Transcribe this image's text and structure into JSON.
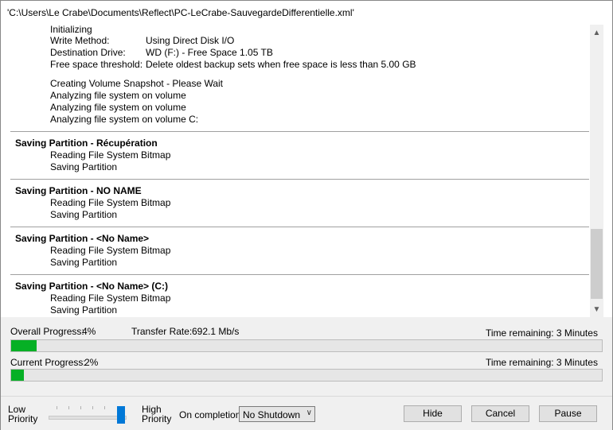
{
  "window": {
    "title": "'C:\\Users\\Le Crabe\\Documents\\Reflect\\PC-LeCrabe-SauvegardeDifferentielle.xml'"
  },
  "log": {
    "init": "Initializing",
    "params": [
      {
        "key": "Write Method:",
        "value": "Using Direct Disk I/O"
      },
      {
        "key": "Destination Drive:",
        "value": "WD (F:) - Free Space 1.05 TB"
      },
      {
        "key": "Free space threshold:",
        "value": "Delete oldest backup sets when free space is less than 5.00 GB"
      }
    ],
    "snapshot_lines": [
      "Creating Volume Snapshot - Please Wait",
      "Analyzing file system on volume",
      "Analyzing file system on volume",
      "Analyzing file system on volume C:"
    ],
    "sections": [
      {
        "title": "Saving Partition - Récupération",
        "lines": [
          "Reading File System Bitmap",
          "Saving Partition"
        ]
      },
      {
        "title": "Saving Partition - NO NAME",
        "lines": [
          "Reading File System Bitmap",
          "Saving Partition"
        ]
      },
      {
        "title": "Saving Partition - <No Name>",
        "lines": [
          "Reading File System Bitmap",
          "Saving Partition"
        ]
      },
      {
        "title": "Saving Partition - <No Name> (C:)",
        "lines": [
          "Reading File System Bitmap",
          "Saving Partition"
        ]
      }
    ]
  },
  "progress": {
    "overall_label": "Overall Progress:",
    "overall_value": "4%",
    "overall_fraction": 0.04,
    "transfer_label": "Transfer Rate:",
    "transfer_value": "692.1 Mb/s",
    "overall_remaining": "Time remaining: 3 Minutes",
    "current_label": "Current Progress:",
    "current_value": "2%",
    "current_fraction": 0.02,
    "current_remaining": "Time remaining: 3 Minutes",
    "fill_color": "#06b025"
  },
  "controls": {
    "low_priority": "Low Priority",
    "high_priority": "High Priority",
    "priority_level": 1.0,
    "on_completion_label": "On completion",
    "on_completion_value": "No Shutdown",
    "hide": "Hide",
    "cancel": "Cancel",
    "pause": "Pause"
  }
}
